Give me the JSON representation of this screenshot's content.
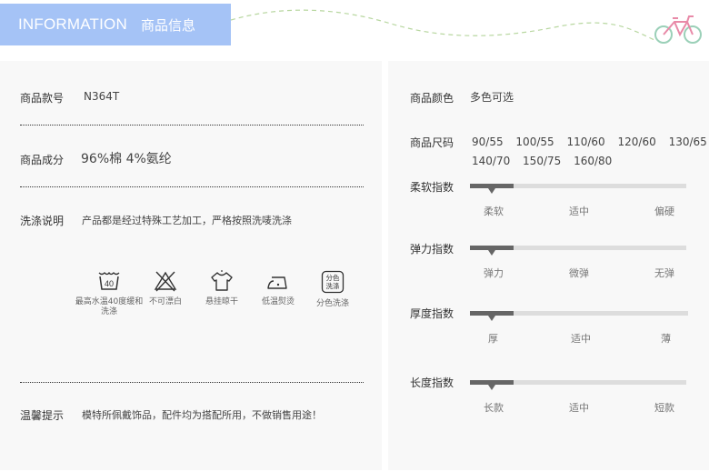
{
  "header": {
    "title_en": "INFORMATION",
    "title_cn": "商品信息"
  },
  "left": {
    "item_no": {
      "label": "商品款号",
      "value": "N364T"
    },
    "composition": {
      "label": "商品成分",
      "value": "96%棉  4%氨纶"
    },
    "washing": {
      "label": "洗涤说明",
      "value": "产品都是经过特殊工艺加工，严格按照洗唛洗涤"
    },
    "care_icons": [
      {
        "icon": "wash-40-icon",
        "tub_text": "40",
        "caption": "最高水温40度缓和洗涤"
      },
      {
        "icon": "no-bleach-icon",
        "caption": "不可漂白"
      },
      {
        "icon": "hang-dry-icon",
        "caption": "悬挂晾干"
      },
      {
        "icon": "low-iron-icon",
        "caption": "低温熨烫"
      },
      {
        "icon": "separate-wash-icon",
        "box_text": [
          "分色",
          "洗涤"
        ],
        "caption": "分色洗涤"
      }
    ],
    "notice": {
      "label": "温馨提示",
      "value": "模特所佩戴饰品，配件均为搭配所用，不做销售用途！"
    }
  },
  "right": {
    "color": {
      "label": "商品颜色",
      "value": "多色可选"
    },
    "size": {
      "label": "商品尺码",
      "row1": [
        "90/55",
        "100/55",
        "110/60",
        "120/60",
        "130/65"
      ],
      "row2": [
        "140/70",
        "150/75",
        "160/80"
      ]
    },
    "indices": [
      {
        "label": "柔软指数",
        "ticks": [
          "柔软",
          "适中",
          "偏硬"
        ],
        "level": 0.2
      },
      {
        "label": "弹力指数",
        "ticks": [
          "弹力",
          "微弹",
          "无弹"
        ],
        "level": 0.2
      },
      {
        "label": "厚度指数",
        "ticks": [
          "厚",
          "适中",
          "薄"
        ],
        "level": 0.2
      },
      {
        "label": "长度指数",
        "ticks": [
          "长款",
          "适中",
          "短款"
        ],
        "level": 0.2
      }
    ]
  },
  "colors": {
    "banner": "#a5c3f6",
    "track": "#dddddd",
    "fill": "#666666"
  }
}
